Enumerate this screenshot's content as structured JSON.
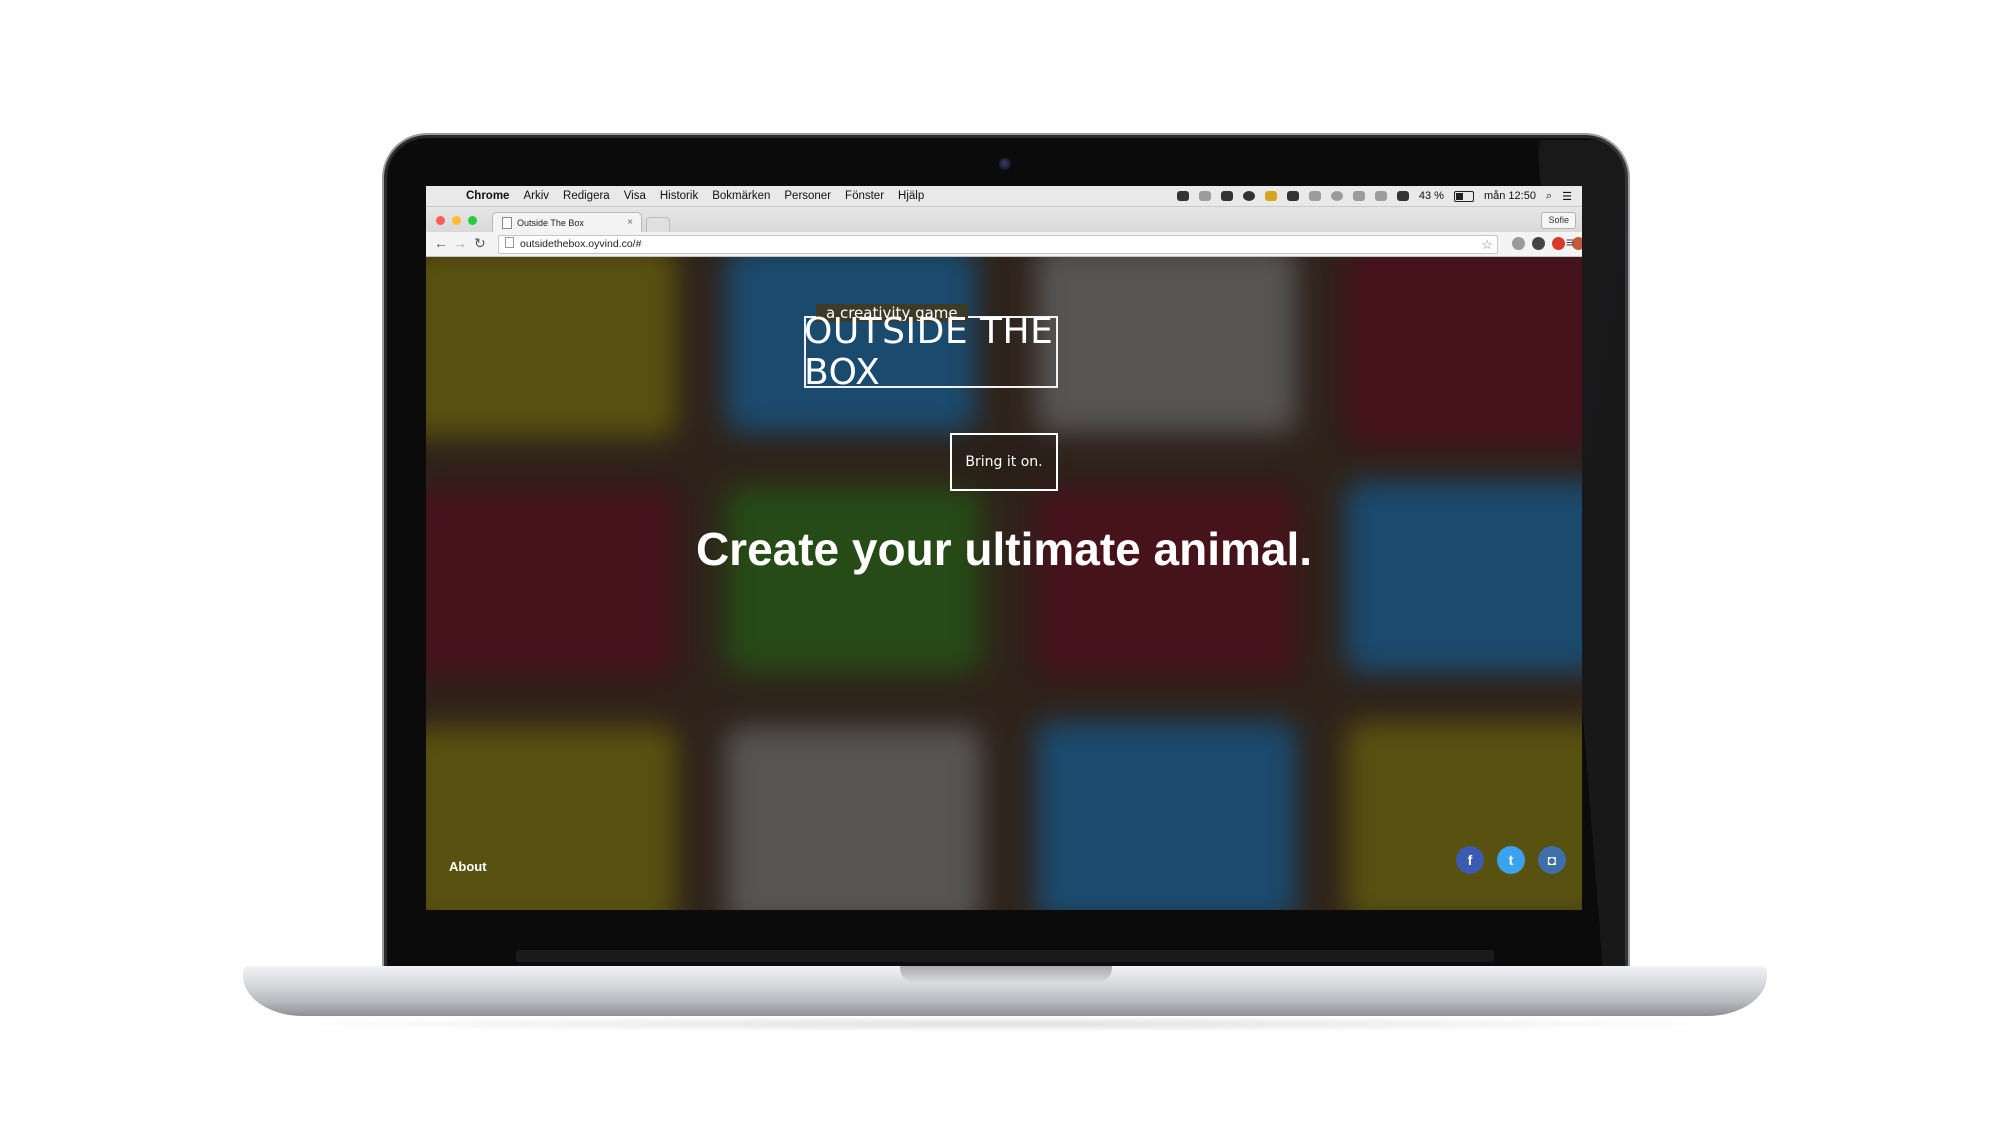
{
  "menubar": {
    "app": "Chrome",
    "items": [
      "Arkiv",
      "Redigera",
      "Visa",
      "Historik",
      "Bokmärken",
      "Personer",
      "Fönster",
      "Hjälp"
    ],
    "battery": "43 %",
    "clock": "mån 12:50"
  },
  "browser": {
    "tab_title": "Outside The Box",
    "tab_close": "×",
    "profile": "Sofie",
    "url": "outsidethebox.oyvind.co/#"
  },
  "page": {
    "tagline": "a creativity game",
    "title": "OUTSIDE THE BOX",
    "cta": "Bring it on.",
    "headline": "Create your ultimate animal.",
    "footer_link": "About",
    "social": {
      "facebook": "f",
      "twitter": "t",
      "instagram": "◘"
    }
  },
  "colors": {
    "tile_yellow": "#7a7412",
    "tile_blue": "#1b6aa4",
    "tile_gray": "#777a7c",
    "tile_maroon": "#5e1424",
    "tile_green": "#2d6a1d",
    "facebook": "#3b5bb0",
    "twitter": "#3ba2f0",
    "instagram": "#3e6fa9"
  }
}
